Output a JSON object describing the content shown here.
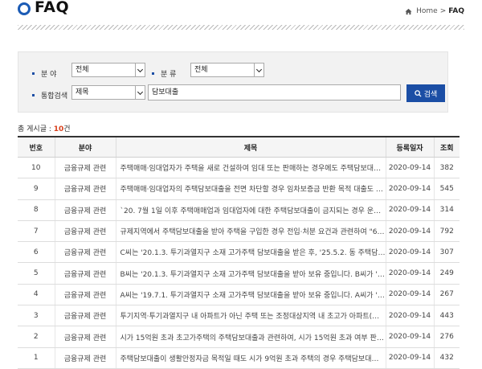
{
  "header": {
    "title": "FAQ",
    "breadcrumb": {
      "home": "Home",
      "separator": ">",
      "current": "FAQ"
    }
  },
  "search": {
    "category_label": "분 야",
    "category_value": "전체",
    "type_label": "분 류",
    "type_value": "전체",
    "combined_label": "통합검색",
    "field_value": "제목",
    "query_value": "담보대출",
    "button_label": "검색"
  },
  "summary": {
    "prefix": "총 게시글 : ",
    "count": "10",
    "suffix": "건"
  },
  "table": {
    "headers": [
      "번호",
      "분야",
      "제목",
      "등록일자",
      "조회"
    ],
    "rows": [
      {
        "no": "10",
        "field": "금융규제 관련",
        "subject": "주택매매·임대업자가 주택을 새로 건설하여 임대 또는 판매하는 경우에도 주택담보대출이…",
        "date": "2020-09-14",
        "views": "382"
      },
      {
        "no": "9",
        "field": "금융규제 관련",
        "subject": "주택매매·임대업자의 주택담보대출을 전면 차단할 경우 임차보증금 반환 목적 대출도 금지…",
        "date": "2020-09-14",
        "views": "545"
      },
      {
        "no": "8",
        "field": "금융규제 관련",
        "subject": "`20. 7월 1일 이후 주택매매업과 임대업자에 대한 주택담보대출이 금지되는 경우 운전자금…",
        "date": "2020-09-14",
        "views": "314"
      },
      {
        "no": "7",
        "field": "금융규제 관련",
        "subject": "규제지역에서 주택담보대출을 받아 주택을 구입한 경우 전입·처분 요건과 관련하여 \"6개월…",
        "date": "2020-09-14",
        "views": "792"
      },
      {
        "no": "6",
        "field": "금융규제 관련",
        "subject": "C씨는 '20.1.3. 투기과열지구 소재 고가주택 담보대출을 받은 후, '25.5.2. 동 주택담보대출…",
        "date": "2020-09-14",
        "views": "307"
      },
      {
        "no": "5",
        "field": "금융규제 관련",
        "subject": "B씨는 '20.1.3. 투기과열지구 소재 고가주택 담보대출을 받아 보유 중입니다. B씨가 '20.5.1…",
        "date": "2020-09-14",
        "views": "249"
      },
      {
        "no": "4",
        "field": "금융규제 관련",
        "subject": "A씨는 '19.7.1. 투기과열지구 소재 고가주택 담보대출을 받아 보유 중입니다. A씨가 '19.12.…",
        "date": "2020-09-14",
        "views": "267"
      },
      {
        "no": "3",
        "field": "금융규제 관련",
        "subject": "투기지역·투기과열지구 내 아파트가 아닌 주택 또는 조정대상지역 내 초고가 아파트(시가 1…",
        "date": "2020-09-14",
        "views": "443"
      },
      {
        "no": "2",
        "field": "금융규제 관련",
        "subject": "시가 15억원 초과 초고가주택의 주택담보대출과 관련하여, 시가 15억원 초과 여부 판단, 대…",
        "date": "2020-09-14",
        "views": "276"
      },
      {
        "no": "1",
        "field": "금융규제 관련",
        "subject": "주택담보대출이 생활안정자금 목적일 때도 시가 9억원 초과 주택의 경우 주택담보대출 LTV…",
        "date": "2020-09-14",
        "views": "432"
      }
    ]
  },
  "colors": {
    "accent": "#1b4ea5",
    "title_icon": "#1b5bb5",
    "count": "#d9401c"
  },
  "icons": {
    "title": "circle-icon",
    "home": "home-icon",
    "search": "search-icon",
    "dropdown": "chevron-down-icon"
  }
}
